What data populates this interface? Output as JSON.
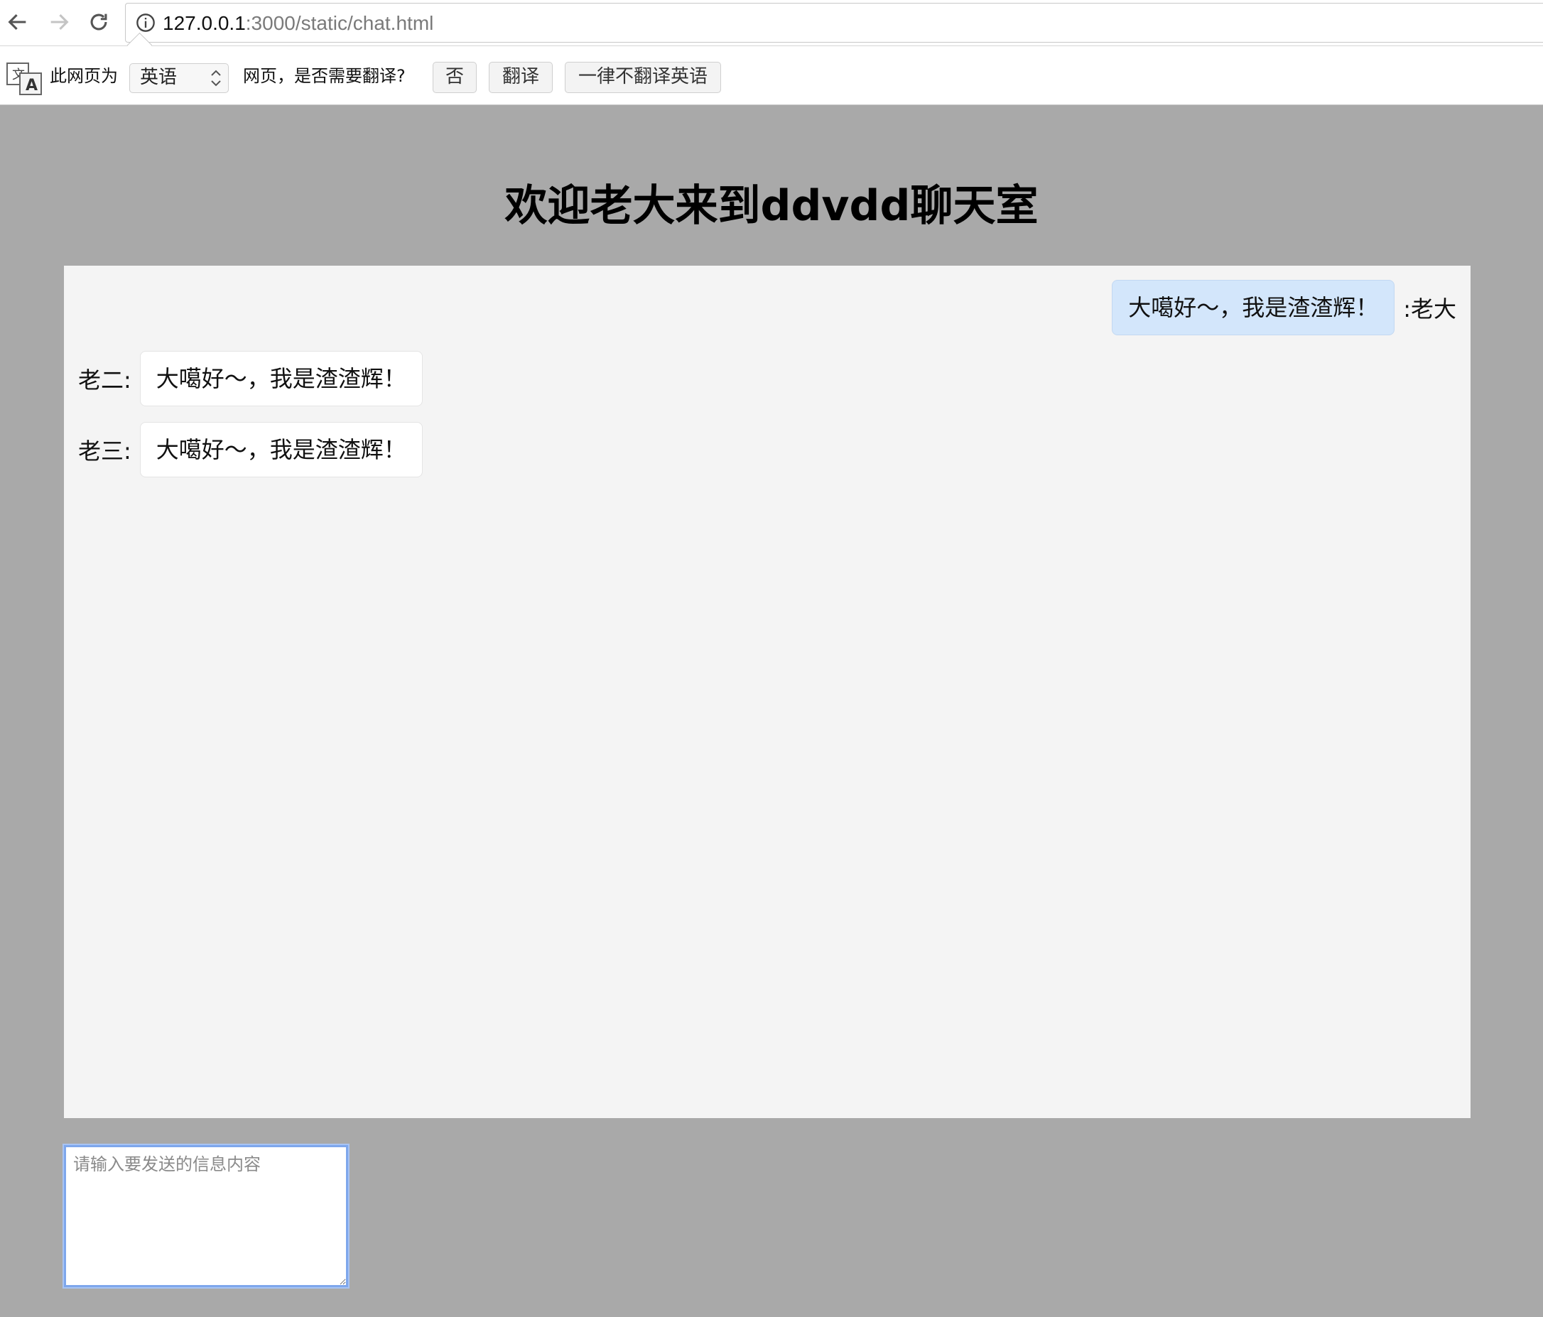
{
  "browser": {
    "url_host": "127.0.0.1",
    "url_rest": ":3000/static/chat.html",
    "icons": [
      "back-icon",
      "forward-icon",
      "reload-icon",
      "info-icon"
    ]
  },
  "translate_bar": {
    "prefix": "此网页为",
    "language": "英语",
    "suffix": "网页，是否需要翻译?",
    "no_label": "否",
    "translate_label": "翻译",
    "never_label": "一律不翻译英语"
  },
  "page": {
    "title": "欢迎老大来到ddvdd聊天室",
    "input_placeholder": "请输入要发送的信息内容"
  },
  "messages": [
    {
      "sender": "老大",
      "text": "大噶好～，我是渣渣辉！",
      "self": true,
      "label": ":老大"
    },
    {
      "sender": "老二",
      "text": "大噶好～，我是渣渣辉！",
      "self": false,
      "label": "老二:"
    },
    {
      "sender": "老三",
      "text": "大噶好～，我是渣渣辉！",
      "self": false,
      "label": "老三:"
    }
  ],
  "colors": {
    "page_bg": "#a9a9a9",
    "chat_bg": "#f4f4f4",
    "self_bubble": "#d3e6fb",
    "other_bubble": "#ffffff",
    "input_focus": "#7ea7ec"
  }
}
